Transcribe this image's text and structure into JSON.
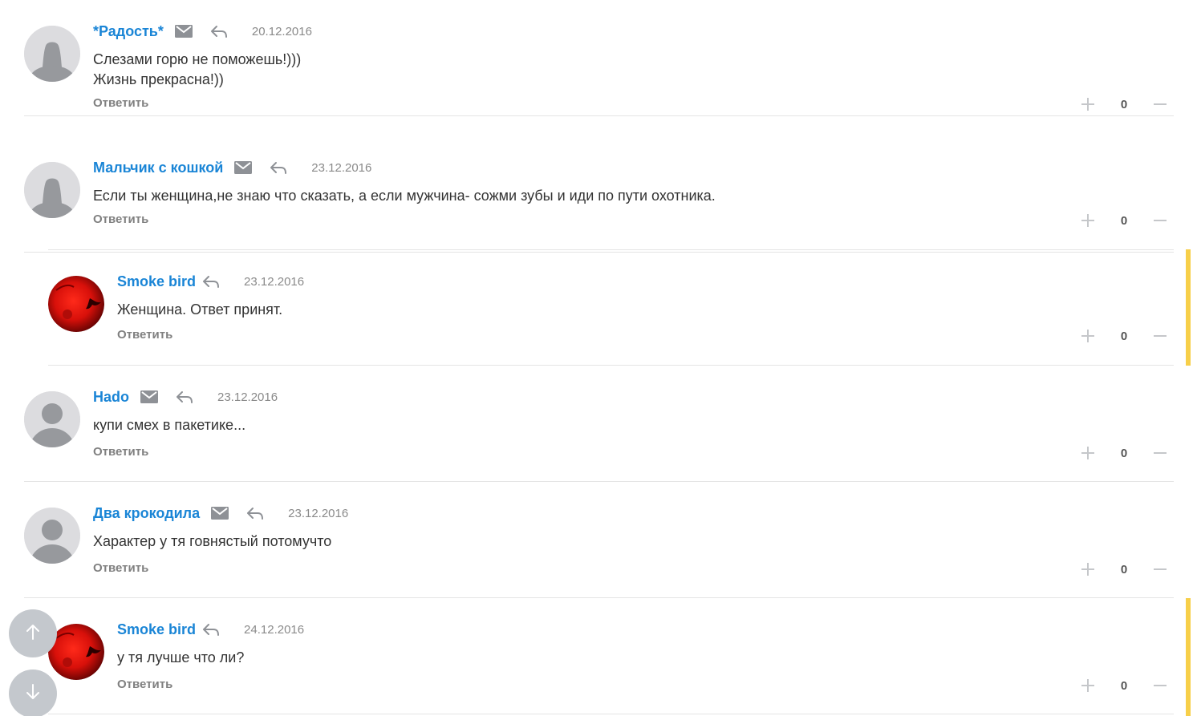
{
  "colors": {
    "author": "#1a85d6",
    "highlight": "#f7cf49",
    "date": "#8a8a8a",
    "answer": "#808080"
  },
  "comments": [
    {
      "author": "*Радость*",
      "date": "20.12.2016",
      "text": "Слезами горю не поможешь!)))\nЖизнь прекрасна!))",
      "answer_label": "Ответить",
      "votes": "0",
      "avatar": "default-avatar-icon",
      "has_mail": true
    },
    {
      "author": "Мальчик с кошкой",
      "date": "23.12.2016",
      "text": "Если ты женщина,не знаю что сказать, а если мужчина- сожми зубы и иди по пути охотника.",
      "answer_label": "Ответить",
      "votes": "0",
      "avatar": "default-avatar-icon",
      "has_mail": true
    },
    {
      "author": "Smoke bird",
      "date": "23.12.2016",
      "text": "Женщина. Ответ принят.",
      "answer_label": "Ответить",
      "votes": "0",
      "avatar": "user-photo",
      "has_mail": false,
      "is_reply": true
    },
    {
      "author": "Hado",
      "date": "23.12.2016",
      "text": "купи смех в пакетике...",
      "answer_label": "Ответить",
      "votes": "0",
      "avatar": "default-avatar-icon",
      "has_mail": true
    },
    {
      "author": "Два крокодила",
      "date": "23.12.2016",
      "text": "Характер у тя говнястый потомучто",
      "answer_label": "Ответить",
      "votes": "0",
      "avatar": "default-avatar-icon",
      "has_mail": true
    },
    {
      "author": "Smoke bird",
      "date": "24.12.2016",
      "text": "у тя лучше что ли?",
      "answer_label": "Ответить",
      "votes": "0",
      "avatar": "user-photo",
      "has_mail": false,
      "is_reply": true
    }
  ],
  "icons": {
    "mail": "envelope-icon",
    "reply": "reply-arrow-icon",
    "plus": "plus-icon",
    "minus": "minus-icon",
    "scroll_up": "arrow-up-icon",
    "scroll_down": "arrow-down-icon"
  }
}
